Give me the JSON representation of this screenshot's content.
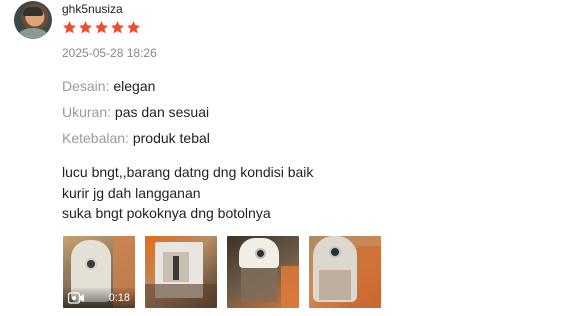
{
  "review": {
    "username": "ghk5nusiza",
    "rating": 5,
    "star_color": "#ee4d2d",
    "timestamp": "2025-05-28 18:26",
    "attributes": [
      {
        "key": "Desain:",
        "value": "elegan"
      },
      {
        "key": "Ukuran:",
        "value": "pas dan sesuai"
      },
      {
        "key": "Ketebalan:",
        "value": "produk tebal"
      }
    ],
    "comment_lines": [
      "lucu bngt,,barang datng dng kondisi baik",
      "kurir jg dah langganan",
      "suka bngt pokoknya dng botolnya"
    ],
    "media": [
      {
        "type": "video",
        "duration": "0:18",
        "icon": "video-camera-icon"
      },
      {
        "type": "image"
      },
      {
        "type": "image"
      },
      {
        "type": "image"
      }
    ]
  }
}
